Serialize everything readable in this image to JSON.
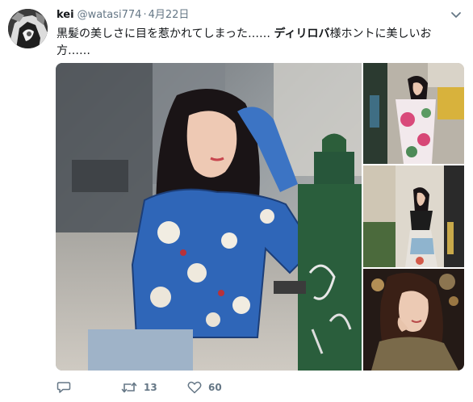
{
  "user": {
    "display_name": "kei",
    "handle": "@watasi774",
    "separator": "·",
    "date": "4月22日"
  },
  "tweet": {
    "text_before": "黒髪の美しさに目を惹かれてしまった…… ",
    "text_bold": "ディリロバ",
    "text_after": "様ホントに美しいお方……"
  },
  "media": {
    "photos": [
      {
        "description_icon": "main-photo"
      },
      {
        "description_icon": "thumbnail-photo"
      },
      {
        "description_icon": "thumbnail-photo"
      },
      {
        "description_icon": "thumbnail-photo"
      }
    ]
  },
  "actions": {
    "reply_count": "",
    "retweet_count": "13",
    "like_count": "60"
  },
  "colors": {
    "text_primary": "#14171a",
    "text_secondary": "#657786"
  }
}
